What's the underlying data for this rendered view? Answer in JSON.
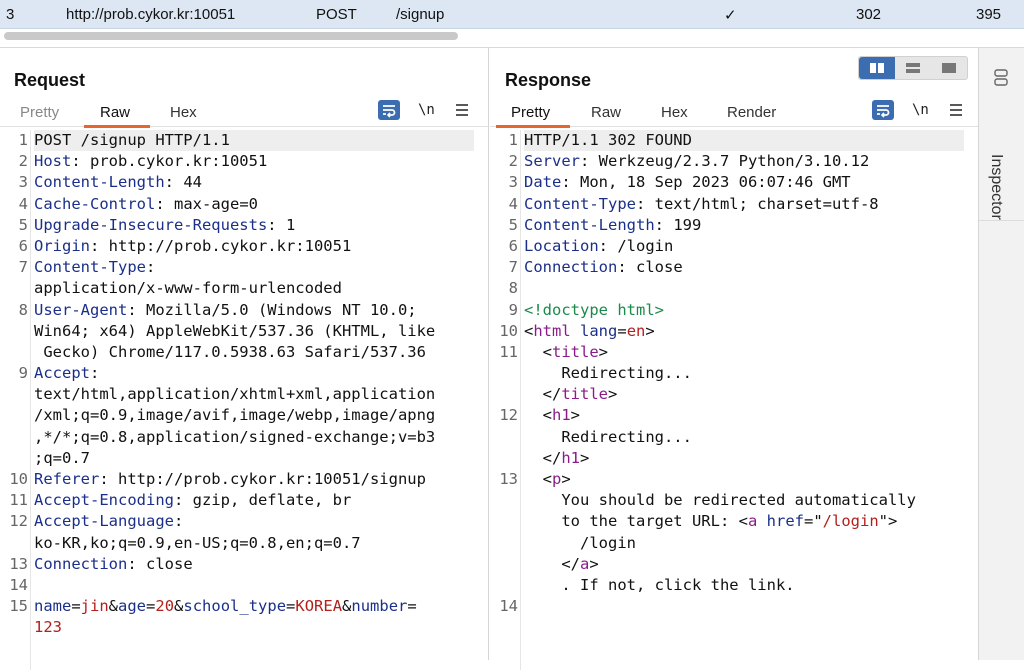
{
  "history_row": {
    "index": "3",
    "host": "http://prob.cykor.kr:10051",
    "method": "POST",
    "path": "/signup",
    "checkmark": "✓",
    "status": "302",
    "length": "395"
  },
  "request": {
    "title": "Request",
    "tabs": [
      "Pretty",
      "Raw",
      "Hex"
    ],
    "newline_label": "\\n",
    "line_numbers": [
      "1",
      "2",
      "3",
      "4",
      "5",
      "6",
      "7",
      "",
      "8",
      "",
      "",
      "9",
      "",
      "",
      "",
      "",
      "10",
      "11",
      "12",
      "",
      "13",
      "14",
      "15",
      ""
    ],
    "lines": [
      "POST /signup HTTP/1.1",
      "Host: prob.cykor.kr:10051",
      "Content-Length: 44",
      "Cache-Control: max-age=0",
      "Upgrade-Insecure-Requests: 1",
      "Origin: http://prob.cykor.kr:10051",
      "Content-Type:",
      "application/x-www-form-urlencoded",
      "User-Agent: Mozilla/5.0 (Windows NT 10.0;",
      "Win64; x64) AppleWebKit/537.36 (KHTML, like",
      " Gecko) Chrome/117.0.5938.63 Safari/537.36",
      "Accept:",
      "text/html,application/xhtml+xml,application",
      "/xml;q=0.9,image/avif,image/webp,image/apng",
      ",*/*;q=0.8,application/signed-exchange;v=b3",
      ";q=0.7",
      "Referer: http://prob.cykor.kr:10051/signup",
      "Accept-Encoding: gzip, deflate, br",
      "Accept-Language:",
      "ko-KR,ko;q=0.9,en-US;q=0.8,en;q=0.7",
      "Connection: close",
      "",
      "name=jin&age=20&school_type=KOREA&number=",
      "123"
    ]
  },
  "response": {
    "title": "Response",
    "tabs": [
      "Pretty",
      "Raw",
      "Hex",
      "Render"
    ],
    "newline_label": "\\n",
    "line_numbers": [
      "1",
      "2",
      "3",
      "4",
      "5",
      "6",
      "7",
      "8",
      "9",
      "10",
      "11",
      "",
      "",
      "12",
      "",
      "",
      "13",
      "",
      "",
      "",
      "",
      "",
      "14"
    ],
    "lines": [
      "HTTP/1.1 302 FOUND",
      "Server: Werkzeug/2.3.7 Python/3.10.12",
      "Date: Mon, 18 Sep 2023 06:07:46 GMT",
      "Content-Type: text/html; charset=utf-8",
      "Content-Length: 199",
      "Location: /login",
      "Connection: close",
      "",
      "<!doctype html>",
      "<html lang=en>",
      "  <title>",
      "    Redirecting...",
      "  </title>",
      "  <h1>",
      "    Redirecting...",
      "  </h1>",
      "  <p>",
      "    You should be redirected automatically",
      "    to the target URL: <a href=\"/login\">",
      "      /login",
      "    </a>",
      "    . If not, click the link.",
      ""
    ]
  },
  "inspector": {
    "label": "Inspector"
  },
  "colors": {
    "accent": "#e8662d",
    "button_blue": "#3c6db0",
    "header_key": "#1b2f8a",
    "tag": "#8a1c8a",
    "value": "#b3201b"
  }
}
